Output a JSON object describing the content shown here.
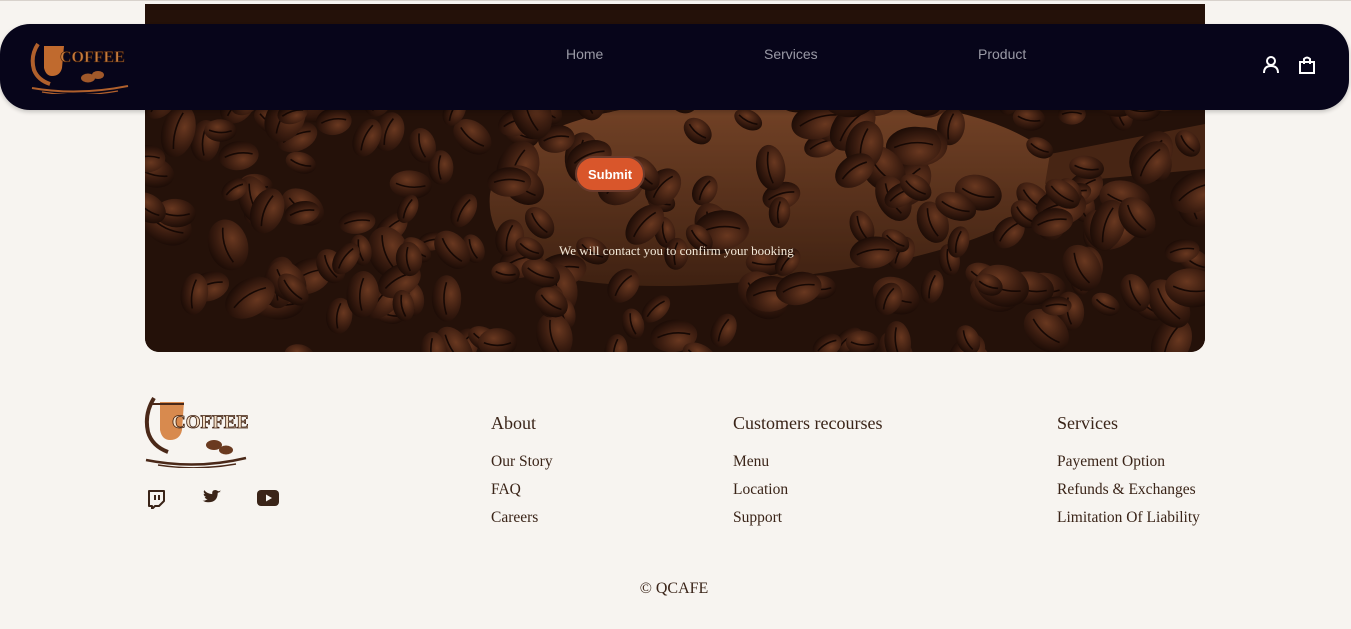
{
  "nav": {
    "links": [
      "Home",
      "Services",
      "Product"
    ],
    "user_icon": "user-icon",
    "cart_icon": "shopping-bag-icon",
    "logo_text": "COFFEE",
    "background": "#07051a"
  },
  "hero": {
    "submit_label": "Submit",
    "confirm_text": "We will contact you to confirm your booking",
    "accent": "#d9562b"
  },
  "footer": {
    "logo_text": "COFFEE",
    "social_icons": [
      "twitch-icon",
      "twitter-icon",
      "youtube-icon"
    ],
    "columns": [
      {
        "title": "About",
        "links": [
          "Our Story",
          "FAQ",
          "Careers"
        ]
      },
      {
        "title": "Customers recourses",
        "links": [
          "Menu",
          "Location",
          "Support"
        ]
      },
      {
        "title": "Services",
        "links": [
          "Payement Option",
          "Refunds & Exchanges",
          "Limitation Of Liability"
        ]
      }
    ],
    "copyright": "© QCAFE"
  }
}
